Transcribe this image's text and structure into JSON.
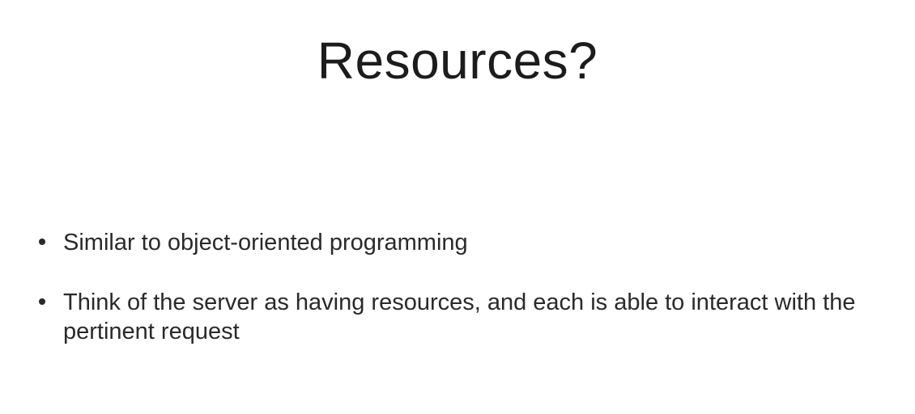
{
  "slide": {
    "title": "Resources?",
    "bullets": [
      {
        "text": "Similar to object-oriented programming"
      },
      {
        "text": "Think of the server as having resources, and each is able to interact with the pertinent request"
      }
    ]
  }
}
